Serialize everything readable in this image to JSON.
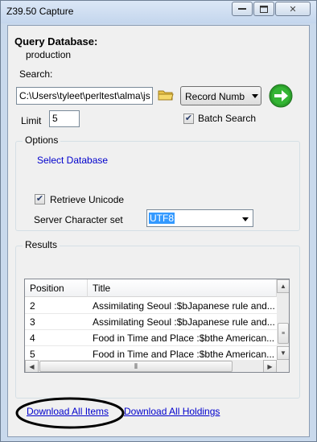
{
  "window": {
    "title": "Z39.50 Capture"
  },
  "header": {
    "label": "Query Database:",
    "database": "production"
  },
  "search": {
    "label": "Search:",
    "path_value": "C:\\Users\\tyleet\\perltest\\alma\\js",
    "type_selected": "Record Numb",
    "limit_label": "Limit",
    "limit_value": "5",
    "batch_label": "Batch Search",
    "batch_checked": true
  },
  "options": {
    "title": "Options",
    "select_db_link": "Select Database",
    "retrieve_unicode_label": "Retrieve Unicode",
    "retrieve_unicode_checked": true,
    "charset_label": "Server Character set",
    "charset_value": "UTF8"
  },
  "results": {
    "title": "Results",
    "columns": [
      "Position",
      "Title"
    ],
    "rows": [
      {
        "position": "2",
        "title": "Assimilating Seoul :$bJapanese rule and..."
      },
      {
        "position": "3",
        "title": "Assimilating Seoul :$bJapanese rule and..."
      },
      {
        "position": "4",
        "title": "Food in Time and Place :$bthe American..."
      },
      {
        "position": "5",
        "title": "Food in Time and Place :$bthe American..."
      }
    ]
  },
  "footer": {
    "download_items": "Download All Items",
    "download_holdings": "Download All Holdings"
  },
  "colors": {
    "accent_green": "#2ca02c",
    "link_blue": "#0000cc",
    "selection": "#3399ff",
    "annotation_ellipse": "#000000"
  },
  "icons": [
    "minimize-icon",
    "maximize-icon",
    "folder-icon",
    "go-arrow-icon",
    "check-icon",
    "dropdown-arrow-icon"
  ]
}
